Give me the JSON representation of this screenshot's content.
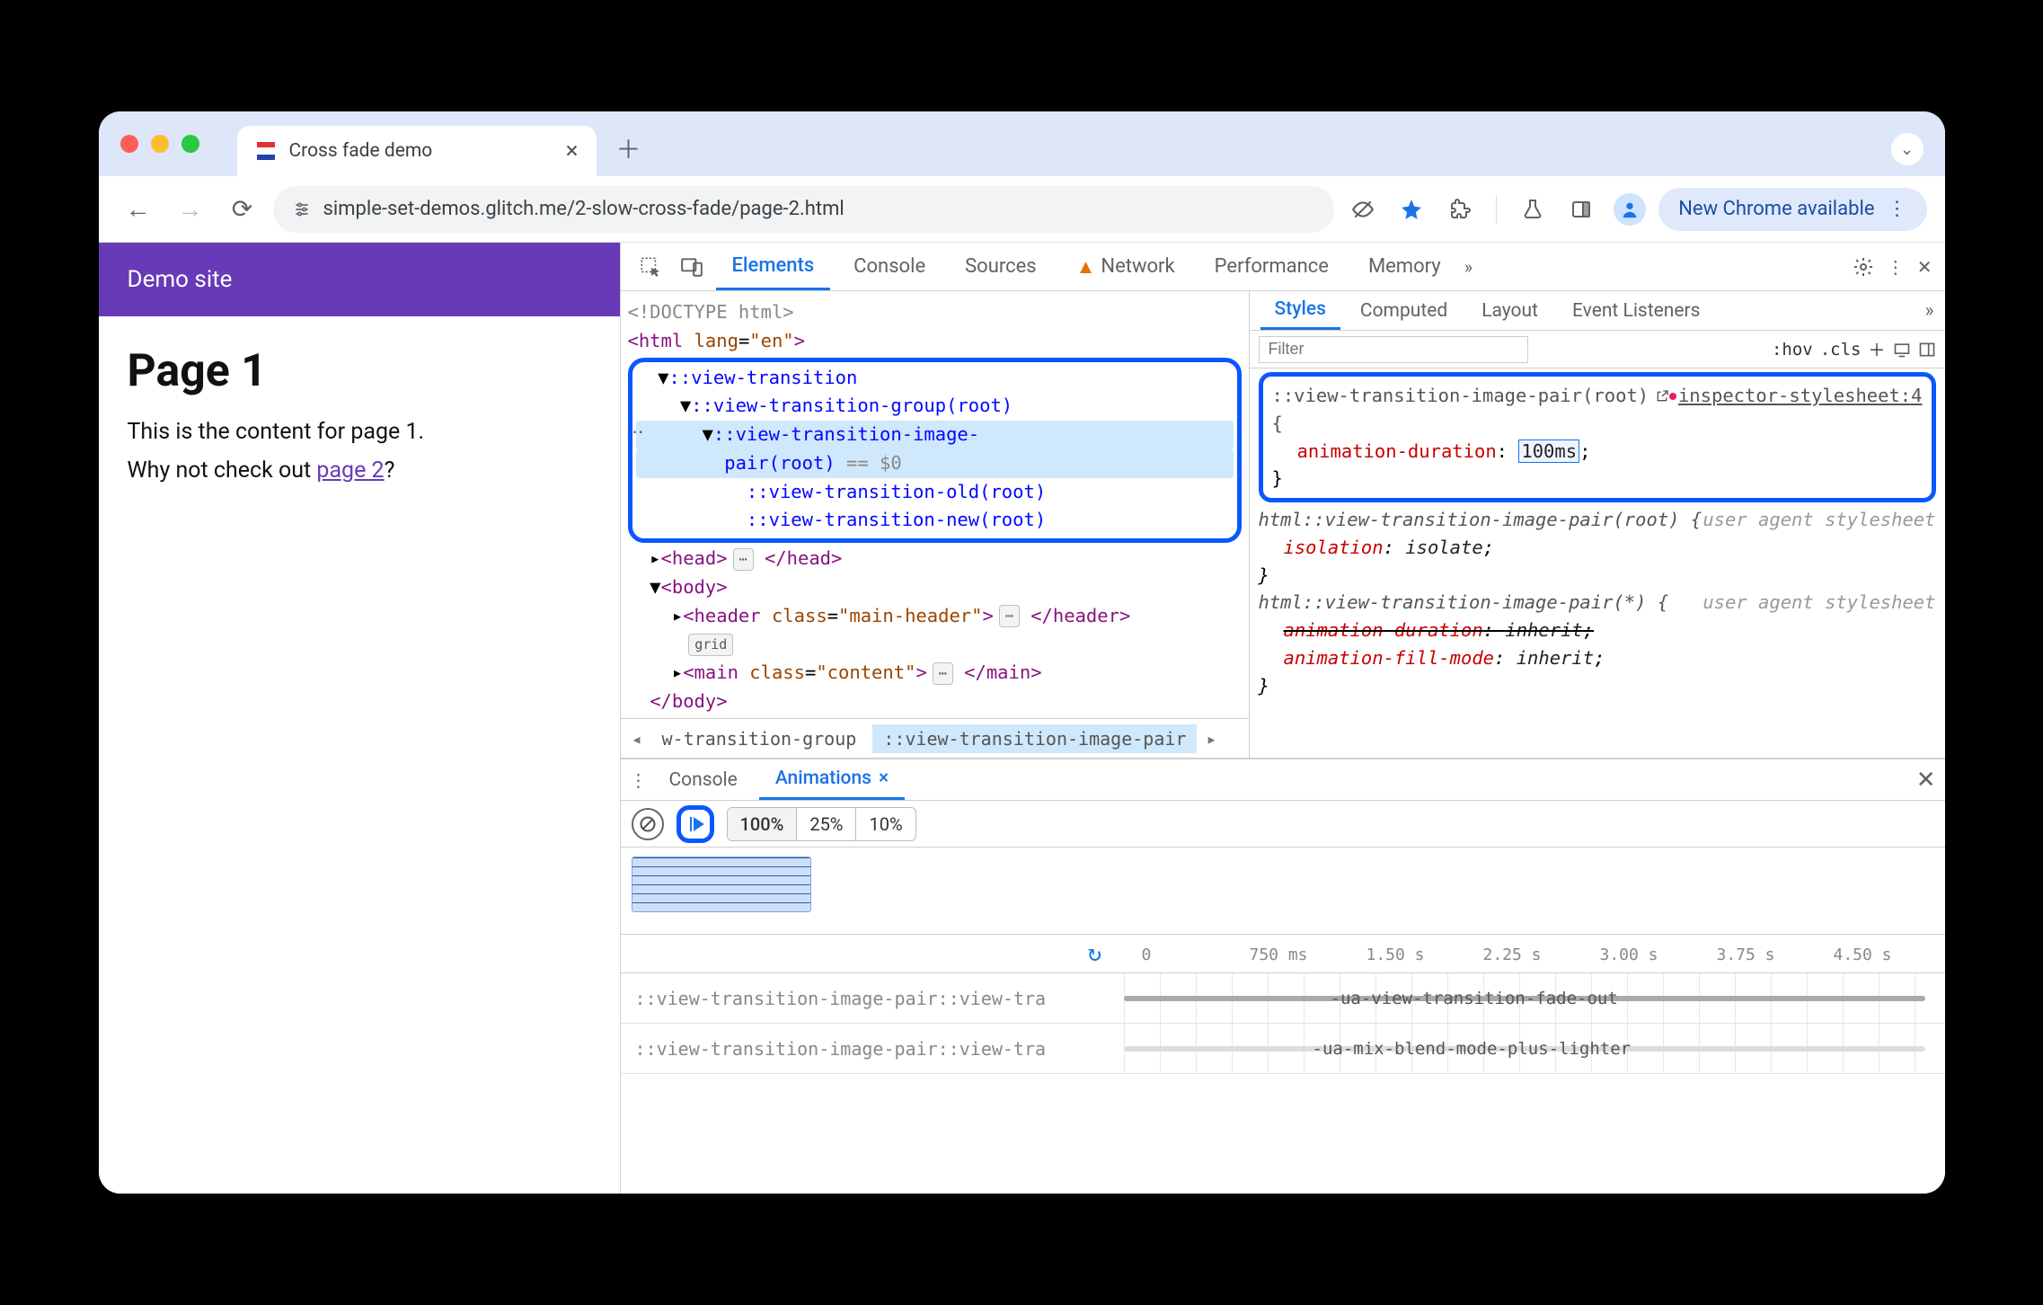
{
  "browser": {
    "tab_title": "Cross fade demo",
    "url": "simple-set-demos.glitch.me/2-slow-cross-fade/page-2.html",
    "update_button": "New Chrome available"
  },
  "page": {
    "header": "Demo site",
    "h1": "Page 1",
    "p1": "This is the content for page 1.",
    "p2_before": "Why not check out ",
    "p2_link": "page 2",
    "p2_after": "?"
  },
  "devtools": {
    "tabs": [
      "Elements",
      "Console",
      "Sources",
      "Network",
      "Performance",
      "Memory"
    ],
    "dom": {
      "doctype": "<!DOCTYPE html>",
      "html_open": "<html lang=\"en\">",
      "vt_root": "::view-transition",
      "vt_group": "::view-transition-group(root)",
      "vt_pair_a": "::view-transition-image-",
      "vt_pair_b": "pair(root)",
      "vt_pair_eq": " == ",
      "vt_pair_dollar": "$0",
      "vt_old": "::view-transition-old(root)",
      "vt_new": "::view-transition-new(root)",
      "head_open": "<head>",
      "head_close": "</head>",
      "body_open": "<body>",
      "header_open": "<header class=\"main-header\">",
      "header_close": "</header>",
      "grid_badge": "grid",
      "main_open": "<main class=\"content\">",
      "main_close": "</main>",
      "body_close": "</body>"
    },
    "breadcrumb": {
      "a": "w-transition-group",
      "b": "::view-transition-image-pair"
    },
    "styles": {
      "tabs": [
        "Styles",
        "Computed",
        "Layout",
        "Event Listeners"
      ],
      "filter_placeholder": "Filter",
      "hov": ":hov",
      "cls": ".cls",
      "rule1": {
        "selector": "::view-transition-image-pair(root) {",
        "origin_label": "inspector-stylesheet:4",
        "prop": "animation-duration",
        "val": "100ms"
      },
      "rule2": {
        "selector": "html::view-transition-image-pair(root) {",
        "origin": "user agent stylesheet",
        "prop": "isolation",
        "val": "isolate"
      },
      "rule3": {
        "selector": "html::view-transition-image-pair(*) {",
        "origin": "user agent stylesheet",
        "prop1": "animation-duration",
        "val1": "inherit",
        "prop2": "animation-fill-mode",
        "val2": "inherit"
      }
    },
    "drawer": {
      "tabs": [
        "Console",
        "Animations"
      ],
      "speeds": [
        "100%",
        "25%",
        "10%"
      ],
      "timeline": {
        "ticks": [
          "0",
          "750 ms",
          "1.50 s",
          "2.25 s",
          "3.00 s",
          "3.75 s",
          "4.50 s"
        ],
        "row1_label": "::view-transition-image-pair::view-tra",
        "row1_name": "-ua-view-transition-fade-out",
        "row2_label": "::view-transition-image-pair::view-tra",
        "row2_name": "-ua-mix-blend-mode-plus-lighter"
      }
    }
  }
}
